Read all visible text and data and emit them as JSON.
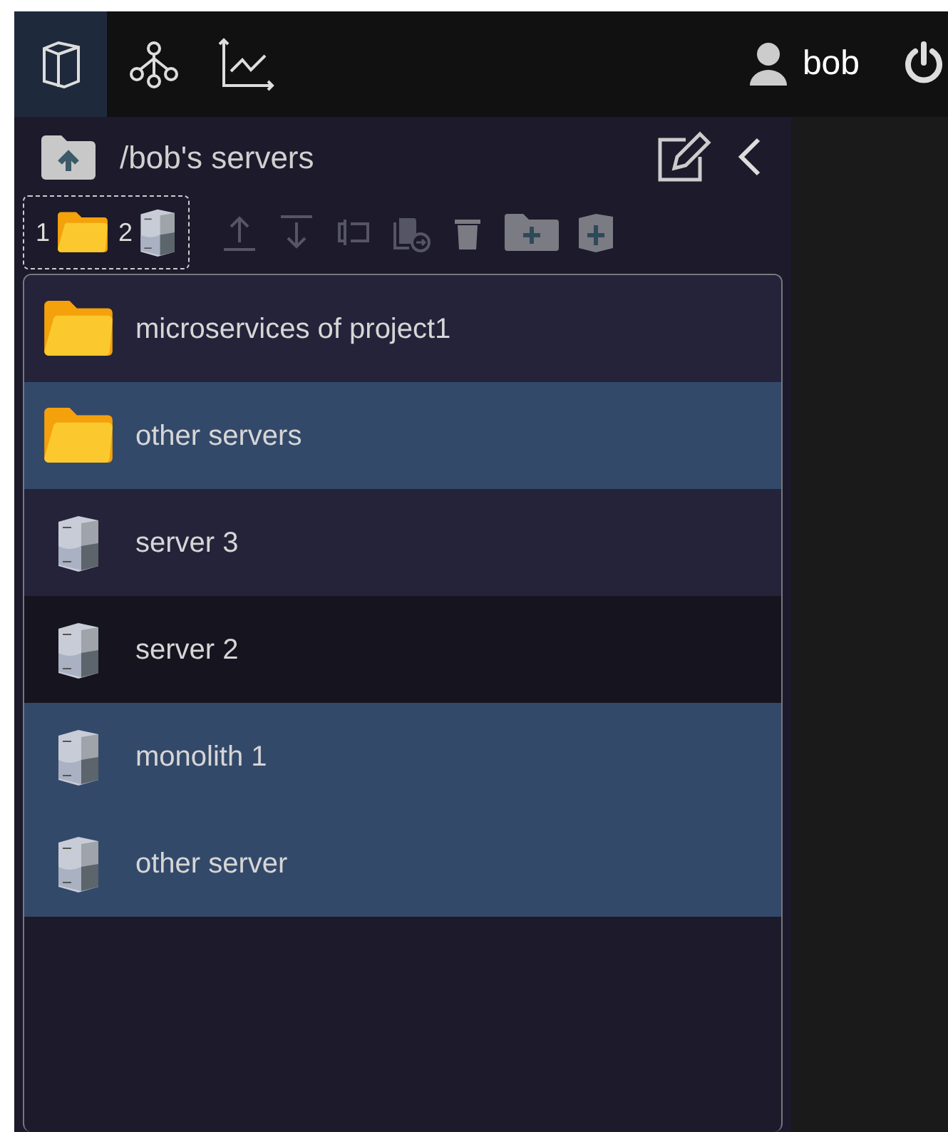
{
  "nav_tabs": [
    {
      "kind": "objects",
      "selected": true
    },
    {
      "kind": "topology",
      "selected": false
    },
    {
      "kind": "chart",
      "selected": false
    }
  ],
  "user": {
    "name": "bob"
  },
  "path": "/bob's servers",
  "selection_counter": {
    "folders": "1",
    "servers": "2"
  },
  "toolbar": [
    {
      "kind": "move-up",
      "disabled": true
    },
    {
      "kind": "move-down",
      "disabled": true
    },
    {
      "kind": "rename",
      "disabled": true
    },
    {
      "kind": "copy",
      "disabled": true
    },
    {
      "kind": "delete",
      "disabled": false
    },
    {
      "kind": "new-folder",
      "disabled": false
    },
    {
      "kind": "new-server",
      "disabled": false
    }
  ],
  "items": [
    {
      "kind": "folder",
      "name": "microservices of project1",
      "selected": false,
      "hovered": false
    },
    {
      "kind": "folder",
      "name": "other servers",
      "selected": true,
      "hovered": false
    },
    {
      "kind": "server",
      "name": "server 3",
      "selected": false,
      "hovered": false
    },
    {
      "kind": "server",
      "name": "server 2",
      "selected": false,
      "hovered": true
    },
    {
      "kind": "server",
      "name": "monolith 1",
      "selected": true,
      "hovered": false
    },
    {
      "kind": "server",
      "name": "other server",
      "selected": true,
      "hovered": false
    }
  ]
}
